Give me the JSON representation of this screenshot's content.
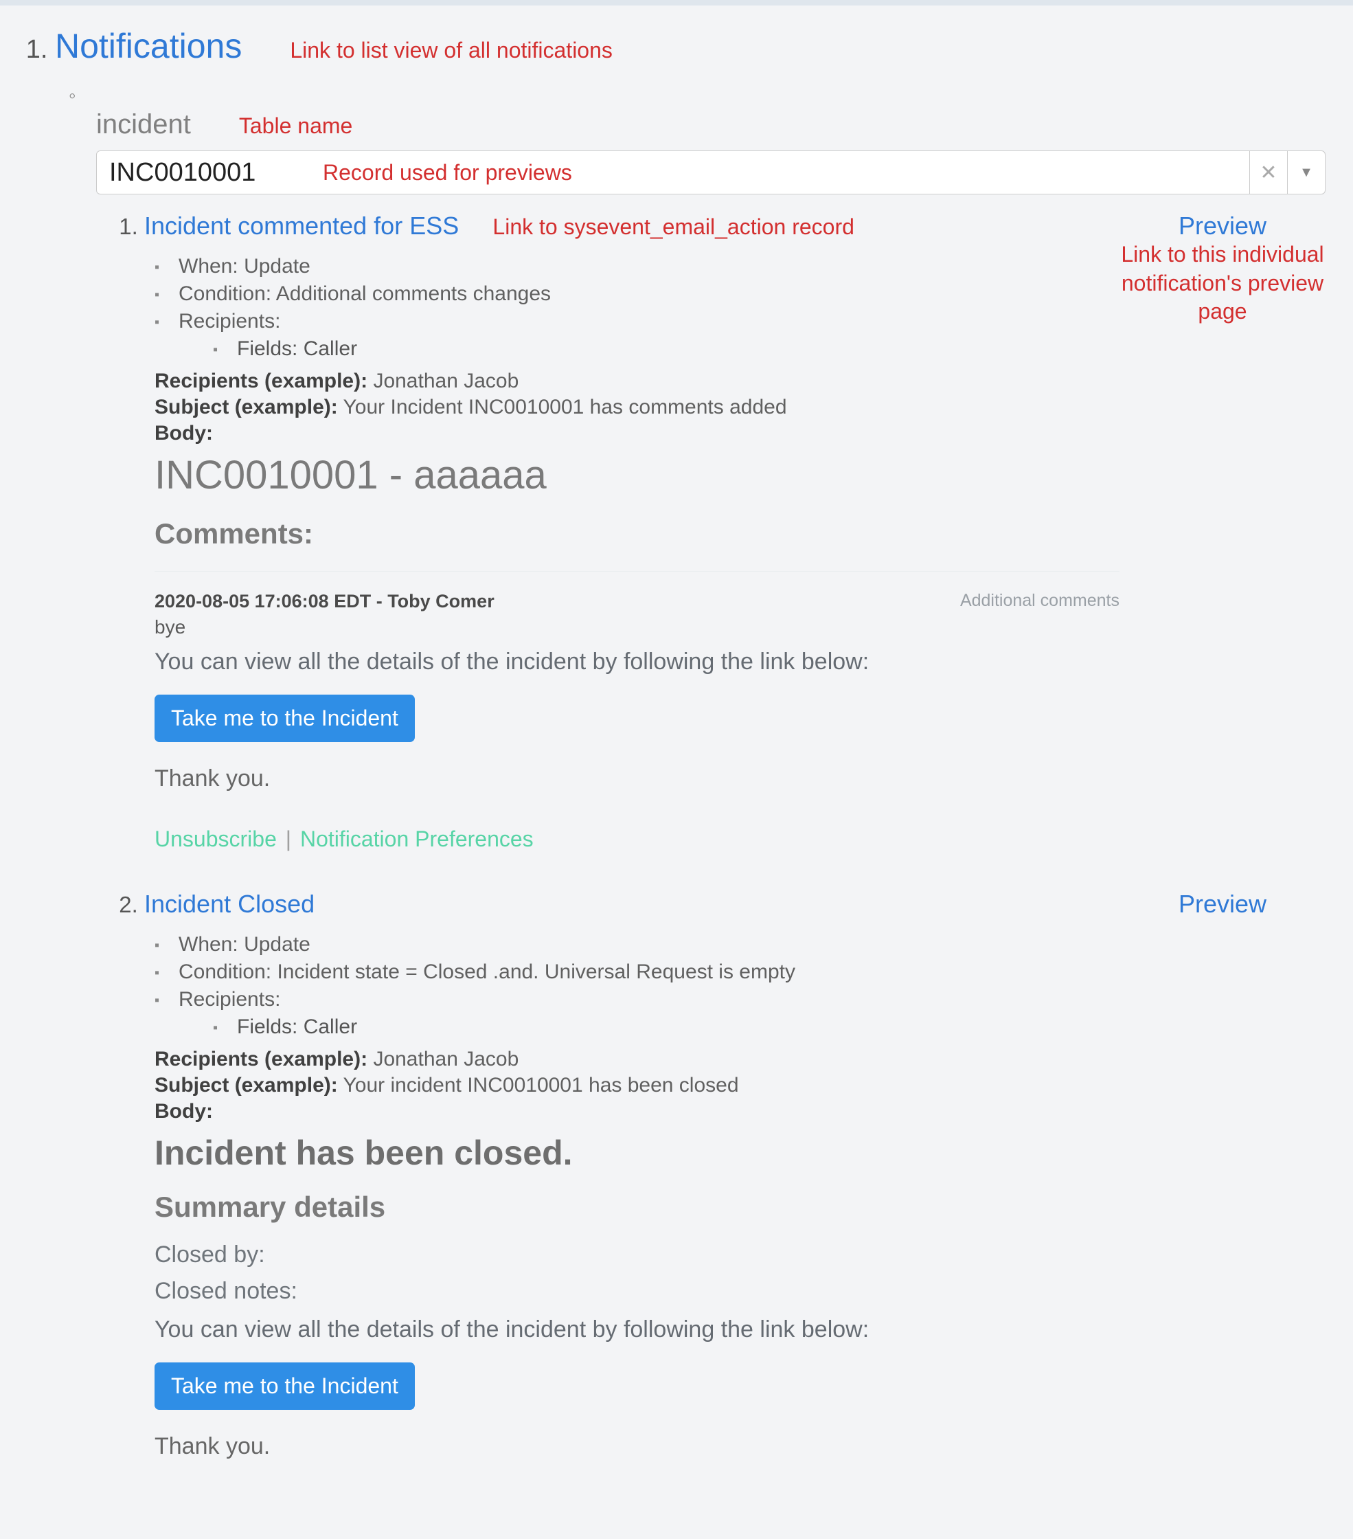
{
  "annotations": {
    "list_link": "Link to list view of all notifications",
    "table_name": "Table name",
    "record_used": "Record used for previews",
    "sysevent_link": "Link to sysevent_email_action record",
    "preview_link": "Link to this individual notification's preview page"
  },
  "heading_link": "Notifications",
  "table": {
    "name": "incident",
    "record_value": "INC0010001"
  },
  "preview_label": "Preview",
  "labels": {
    "when": "When:",
    "condition": "Condition:",
    "recipients": "Recipients:",
    "fields": "Fields:",
    "recipients_example": "Recipients (example):",
    "subject_example": "Subject (example):",
    "body": "Body:"
  },
  "notifications": [
    {
      "title": "Incident commented for ESS",
      "when": "Update",
      "condition": "Additional comments changes",
      "fields": "Caller",
      "recipients_example": "Jonathan Jacob",
      "subject_example": "Your Incident INC0010001 has comments added",
      "body": {
        "h1": "INC0010001 - aaaaaa",
        "h2": "Comments:",
        "comment_meta": "2020-08-05 17:06:08 EDT - Toby Comer",
        "comment_tag": "Additional comments",
        "comment_body": "bye",
        "para": "You can view all the details of the incident by following the link below:",
        "button": "Take me to the Incident",
        "thanks": "Thank you.",
        "unsubscribe": "Unsubscribe",
        "pipe": "|",
        "prefs": "Notification Preferences"
      }
    },
    {
      "title": "Incident Closed",
      "when": "Update",
      "condition": "Incident state = Closed .and. Universal Request is empty",
      "fields": "Caller",
      "recipients_example": "Jonathan Jacob",
      "subject_example": "Your incident INC0010001 has been closed",
      "body": {
        "h1b": "Incident has been closed.",
        "h2b": "Summary details",
        "closed_by": "Closed by:",
        "closed_notes": "Closed notes:",
        "para": "You can view all the details of the incident by following the link below:",
        "button": "Take me to the Incident",
        "thanks": "Thank you."
      }
    }
  ]
}
